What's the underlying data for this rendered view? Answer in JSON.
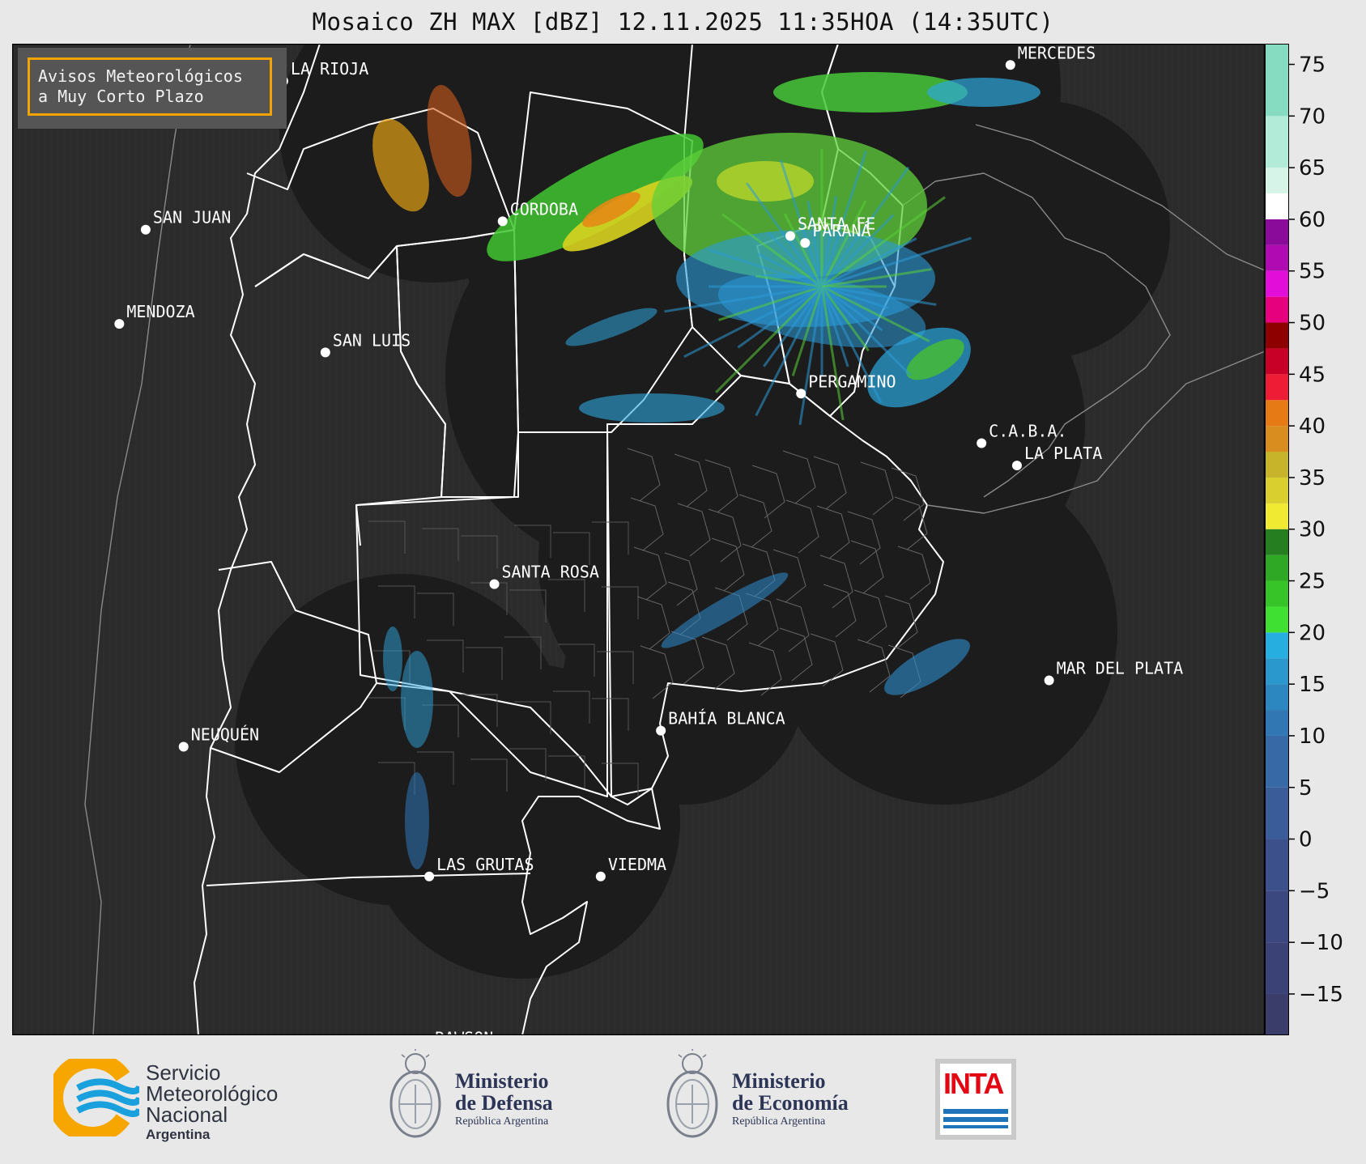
{
  "title": "Mosaico ZH MAX [dBZ] 12.11.2025 11:35HOA (14:35UTC)",
  "notice": {
    "line1": "Avisos Meteorológicos",
    "line2": "a Muy Corto Plazo",
    "border_color": "#f5a300"
  },
  "cities": [
    {
      "name": "LA RIOJA",
      "lon": -66.85,
      "lat": -29.41
    },
    {
      "name": "MERCEDES",
      "lon": -58.03,
      "lat": -29.18
    },
    {
      "name": "SAN JUAN",
      "lon": -68.52,
      "lat": -31.54
    },
    {
      "name": "CORDOBA",
      "lon": -64.19,
      "lat": -31.42
    },
    {
      "name": "SANTA FE",
      "lon": -60.7,
      "lat": -31.63
    },
    {
      "name": "PARANÁ",
      "lon": -60.52,
      "lat": -31.73
    },
    {
      "name": "MENDOZA",
      "lon": -68.84,
      "lat": -32.89
    },
    {
      "name": "SAN LUIS",
      "lon": -66.34,
      "lat": -33.3
    },
    {
      "name": "PERGAMINO",
      "lon": -60.57,
      "lat": -33.89
    },
    {
      "name": "C.A.B.A.",
      "lon": -58.38,
      "lat": -34.6
    },
    {
      "name": "LA PLATA",
      "lon": -57.95,
      "lat": -34.92
    },
    {
      "name": "SANTA ROSA",
      "lon": -64.29,
      "lat": -36.62
    },
    {
      "name": "MAR DEL PLATA",
      "lon": -57.56,
      "lat": -38.0
    },
    {
      "name": "BAHÍA BLANCA",
      "lon": -62.27,
      "lat": -38.72
    },
    {
      "name": "NEUQUÉN",
      "lon": -68.06,
      "lat": -38.95
    },
    {
      "name": "LAS GRUTAS",
      "lon": -65.08,
      "lat": -40.81
    },
    {
      "name": "VIEDMA",
      "lon": -63.0,
      "lat": -40.81
    },
    {
      "name": "RAWSON",
      "lon": -65.1,
      "lat": -43.3
    }
  ],
  "colorbar": {
    "ticks": [
      "75",
      "70",
      "65",
      "60",
      "55",
      "50",
      "45",
      "40",
      "35",
      "30",
      "25",
      "20",
      "15",
      "10",
      "5",
      "0",
      "−5",
      "−10",
      "−15"
    ],
    "range": [
      -19,
      77
    ]
  },
  "logos": {
    "smn": {
      "line1": "Servicio",
      "line2": "Meteorológico",
      "line3": "Nacional",
      "line4": "Argentina"
    },
    "defensa": {
      "line1": "Ministerio",
      "line2": "de Defensa",
      "line3": "República Argentina"
    },
    "economia": {
      "line1": "Ministerio",
      "line2": "de Economía",
      "line3": "República Argentina"
    },
    "inta": {
      "text": "INTA"
    }
  },
  "colors": {
    "map_bg": "#2b2b2b",
    "radar_disc": "#1c1c1c",
    "smn_orange": "#f7a600",
    "smn_blue": "#1aa0dc",
    "inta_red": "#e30613",
    "inta_blue": "#1f74b9"
  }
}
